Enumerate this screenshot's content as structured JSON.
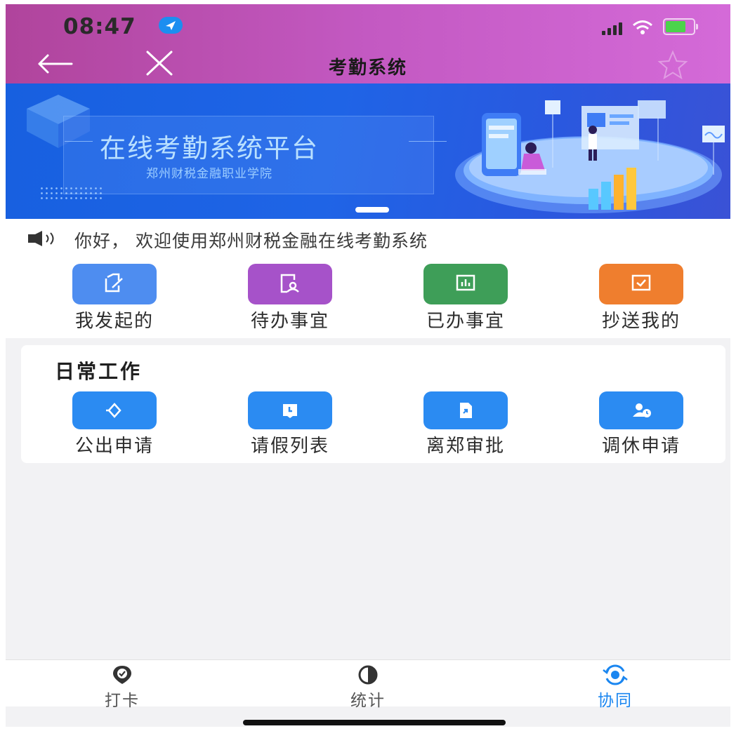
{
  "status_bar": {
    "time": "08:47"
  },
  "nav": {
    "title": "考勤系统"
  },
  "banner": {
    "title": "在线考勤系统平台",
    "subtitle": "郑州财税金融职业学院"
  },
  "notice": {
    "text": "你好， 欢迎使用郑州财税金融在线考勤系统"
  },
  "quick_actions": [
    {
      "label": "我发起的",
      "icon": "initiated-icon",
      "color": "#4e8df0"
    },
    {
      "label": "待办事宜",
      "icon": "todo-icon",
      "color": "#a652c9"
    },
    {
      "label": "已办事宜",
      "icon": "done-icon",
      "color": "#3e9e58"
    },
    {
      "label": "抄送我的",
      "icon": "cc-icon",
      "color": "#ef7e2e"
    }
  ],
  "daily_work": {
    "title": "日常工作",
    "items": [
      {
        "label": "公出申请",
        "icon": "diamond-icon"
      },
      {
        "label": "请假列表",
        "icon": "leave-list-icon"
      },
      {
        "label": "离郑审批",
        "icon": "document-icon"
      },
      {
        "label": "调休申请",
        "icon": "user-clock-icon"
      }
    ],
    "color": "#2b8bf2"
  },
  "tabs": [
    {
      "label": "打卡",
      "icon": "checkin-pin-icon",
      "active": false
    },
    {
      "label": "统计",
      "icon": "pie-chart-icon",
      "active": false
    },
    {
      "label": "协同",
      "icon": "collaborate-icon",
      "active": true
    }
  ],
  "colors": {
    "accent": "#1a86f0",
    "header_start": "#b0449c",
    "header_end": "#d46ad8"
  }
}
